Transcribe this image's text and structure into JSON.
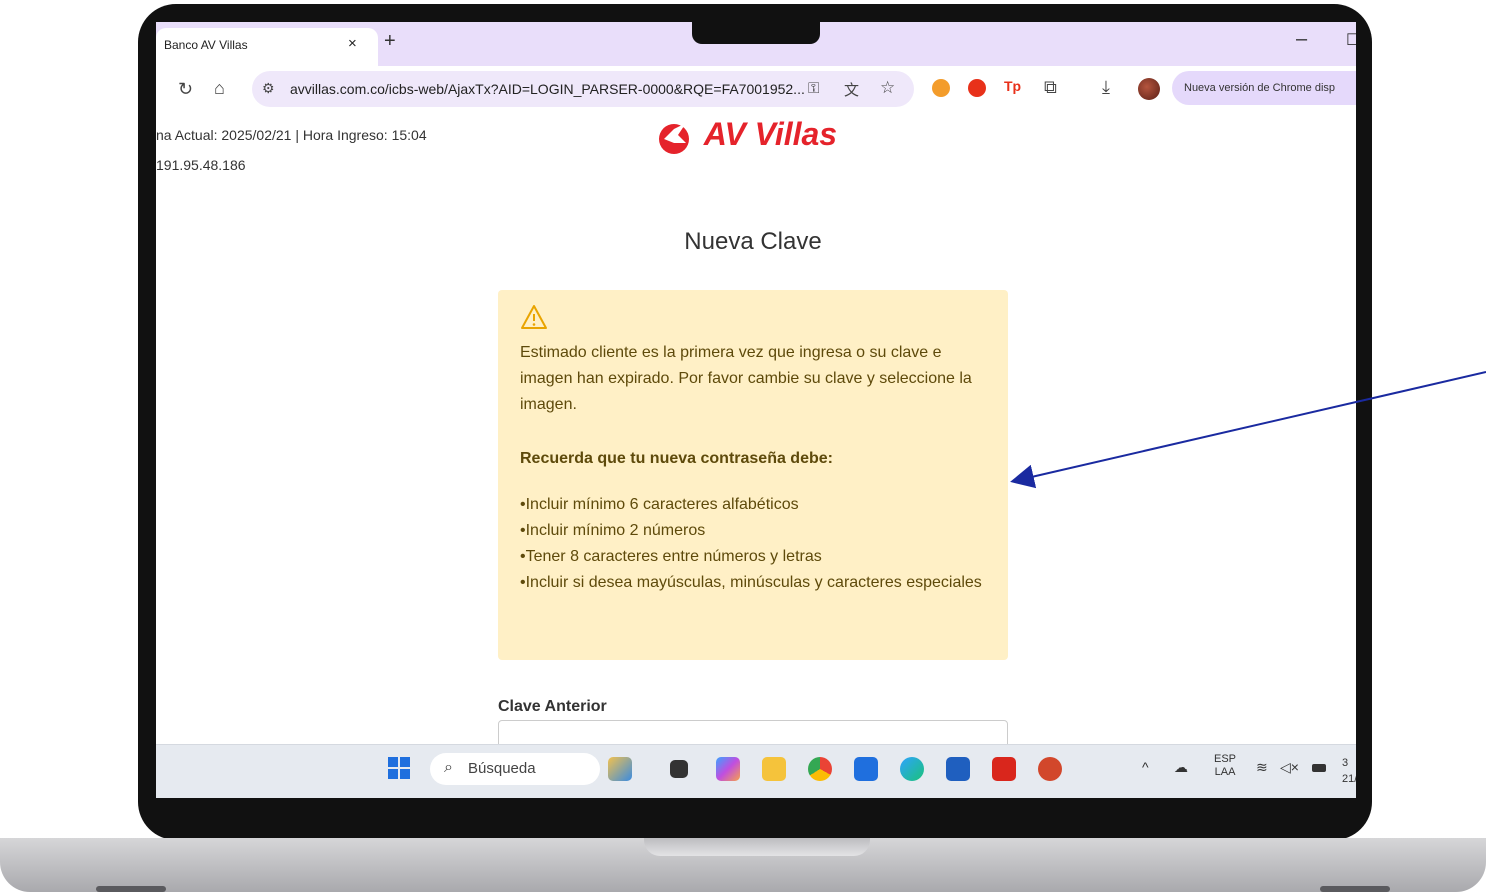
{
  "browser": {
    "tab_title": "Banco AV Villas",
    "tab_close": "×",
    "new_tab": "+",
    "minimize": "–",
    "maximize": "☐",
    "url": "avvillas.com.co/icbs-web/AjaxTx?AID=LOGIN_PARSER-0000&RQE=FA7001952...",
    "chrome_update": "Nueva versión de Chrome disp",
    "icons": [
      "reload-icon",
      "home-icon",
      "site-info-icon",
      "password-key-icon",
      "translate-icon",
      "star-icon",
      "extension-icon-1",
      "extension-icon-2",
      "extension-icon-3",
      "extensions-puzzle-icon",
      "download-icon",
      "profile-avatar"
    ]
  },
  "page": {
    "session_line": "na Actual: 2025/02/21 | Hora Ingreso: 15:04",
    "ip_line": "191.95.48.186",
    "logo_text": "AV Villas",
    "heading": "Nueva Clave",
    "alert": {
      "intro": "Estimado cliente es la primera vez que ingresa o su clave e imagen han expirado. Por favor cambie su clave y seleccione la imagen.",
      "subtitle": "Recuerda que tu nueva contraseña debe:",
      "requirements": [
        "•Incluir mínimo 6 caracteres alfabéticos",
        "•Incluir mínimo 2 números",
        "•Tener 8 caracteres entre números y letras",
        "•Incluir si desea mayúsculas, minúsculas y caracteres especiales"
      ]
    },
    "field_label": "Clave Anterior",
    "field_value": ""
  },
  "taskbar": {
    "search_label": "Búsqueda",
    "lang_top": "ESP",
    "lang_bottom": "LAA",
    "clock_top": "3",
    "clock_bottom": "21/"
  },
  "colors": {
    "brand_red": "#e5232b",
    "alert_bg": "#fff0c6",
    "alert_text": "#5e4a0b",
    "tab_strip": "#e9defa",
    "arrow": "#1a2aa0"
  }
}
